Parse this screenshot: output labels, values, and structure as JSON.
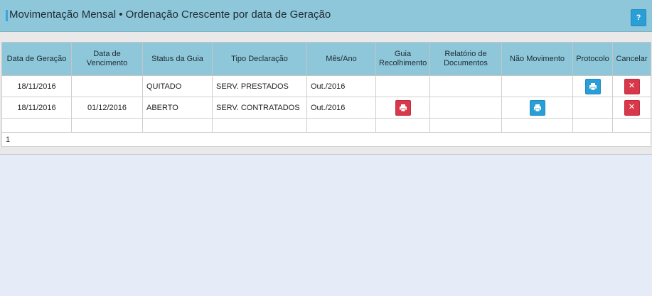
{
  "header": {
    "title": "Movimentação Mensal • Ordenação Crescente por data de Geração",
    "help_label": "?"
  },
  "table": {
    "columns": [
      "Data de Geração",
      "Data de Vencimento",
      "Status da Guia",
      "Tipo Declaração",
      "Mês/Ano",
      "Guia Recolhimento",
      "Relatório de Documentos",
      "Não Movimento",
      "Protocolo",
      "Cancelar"
    ],
    "rows": [
      {
        "data_geracao": "18/11/2016",
        "data_vencimento": "",
        "status": "QUITADO",
        "tipo": "SERV. PRESTADOS",
        "mes_ano": "Out./2016",
        "guia_icon": "",
        "relatorio_icon": "",
        "nao_movimento_icon": "",
        "protocolo_icon": "print-icon",
        "cancelar_icon": "close-icon"
      },
      {
        "data_geracao": "18/11/2016",
        "data_vencimento": "01/12/2016",
        "status": "ABERTO",
        "tipo": "SERV. CONTRATADOS",
        "mes_ano": "Out./2016",
        "guia_icon": "print-icon",
        "relatorio_icon": "",
        "nao_movimento_icon": "print-icon",
        "protocolo_icon": "",
        "cancelar_icon": "close-icon"
      }
    ],
    "footer_page": "1"
  },
  "colors": {
    "header_bg": "#8ec7d9",
    "accent_blue": "#2a9fd6",
    "danger_red": "#d9384a",
    "page_bg": "#e6ecf7"
  }
}
